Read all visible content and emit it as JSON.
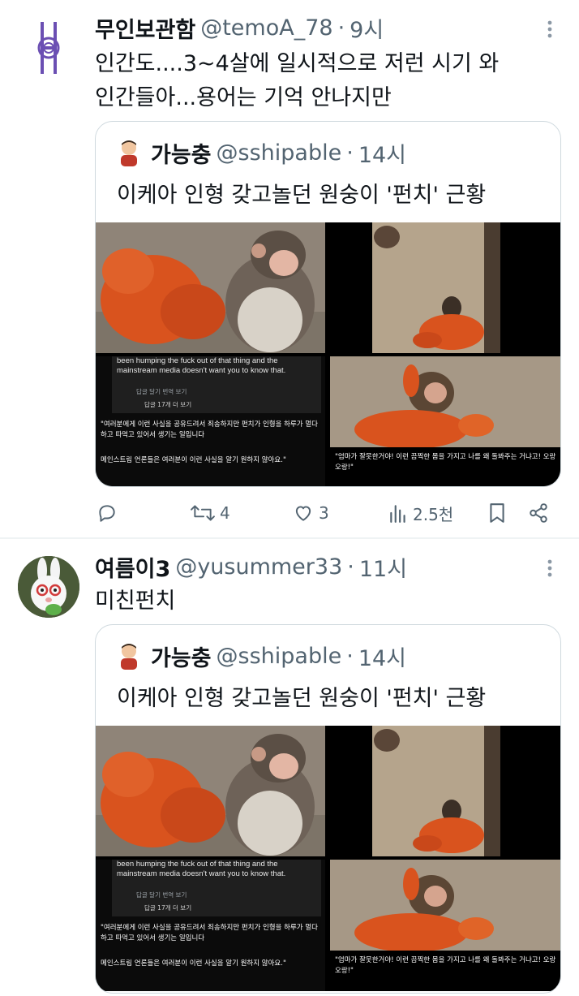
{
  "tweets": [
    {
      "author_name": "무인보관함",
      "author_handle": "@temoA_78",
      "separator": "·",
      "time": "9시",
      "text_lines": [
        "인간도....3~4살에 일시적으로 저런 시기 와",
        "인간들아...용어는 기억 안나지만"
      ],
      "quote": {
        "author_name": "가능충",
        "author_handle": "@sshipable",
        "separator": "·",
        "time": "14시",
        "text": "이케아 인형 갖고놀던 원숭이 '펀치' 근황",
        "media_captions": {
          "en": "been humping the fuck out of that thing and the mainstream media doesn't want you to know that.",
          "meta": "답글 달기    번역 보기",
          "replies_more": "답글 17개 더 보기",
          "ko1": "\"여러분에게 이런 사실을 공유드려서 죄송하지만 펀치가 인형을 하루가 멀다 하고 따먹고 있어서 생기는 일입니다",
          "ko2": "메인스트림 언론들은 여러분이 이런 사실을 알기 원하지 않아요.\"",
          "ko3": "\"엄마가 잘못한거야! 이런 끔찍한 몸을 가지고 나를 왜 돌봐주는 거냐고! 오랑 오랑!\""
        }
      },
      "actions": {
        "retweets": "4",
        "likes": "3",
        "views": "2.5천"
      }
    },
    {
      "author_name": "여름이3",
      "author_handle": "@yusummer33",
      "separator": "·",
      "time": "11시",
      "text_lines": [
        "미친펀치"
      ],
      "quote": {
        "author_name": "가능충",
        "author_handle": "@sshipable",
        "separator": "·",
        "time": "14시",
        "text": "이케아 인형 갖고놀던 원숭이 '펀치' 근황",
        "media_captions": {
          "en": "been humping the fuck out of that thing and the mainstream media doesn't want you to know that.",
          "meta": "답글 달기    번역 보기",
          "replies_more": "답글 17개 더 보기",
          "ko1": "\"여러분에게 이런 사실을 공유드려서 죄송하지만 펀치가 인형을 하루가 멀다 하고 따먹고 있어서 생기는 일입니다",
          "ko2": "메인스트림 언론들은 여러분이 이런 사실을 알기 원하지 않아요.\"",
          "ko3": "\"엄마가 잘못한거야! 이런 끔찍한 몸을 가지고 나를 왜 돌봐주는 거냐고! 오랑 오랑!\""
        }
      }
    }
  ],
  "icons": {
    "more": "more-vertical-icon",
    "reply": "reply-icon",
    "retweet": "retweet-icon",
    "like": "heart-icon",
    "views": "views-chart-icon",
    "bookmark": "bookmark-icon",
    "share": "share-icon"
  },
  "colors": {
    "text": "#0f1419",
    "secondary": "#536471",
    "border": "#cfd9de",
    "plush": "#d9531e",
    "logo_purple": "#6b4fb3"
  }
}
